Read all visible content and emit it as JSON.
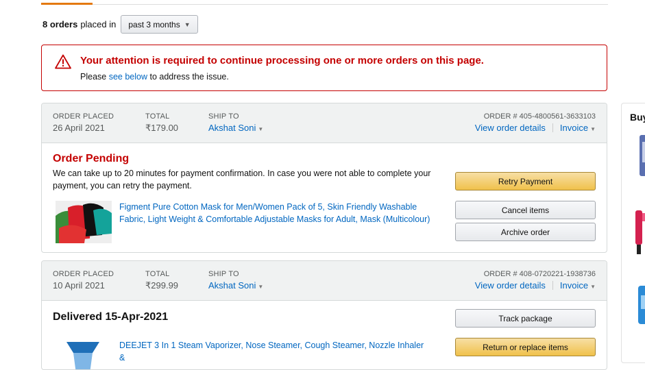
{
  "summary": {
    "count": "8 orders",
    "placed_in": "placed in",
    "period": "past 3 months"
  },
  "alert": {
    "title": "Your attention is required to continue processing one or more orders on this page.",
    "msg_prefix": "Please ",
    "msg_link": "see below",
    "msg_suffix": " to address the issue."
  },
  "header_labels": {
    "order_placed": "ORDER PLACED",
    "total": "TOTAL",
    "ship_to": "SHIP TO"
  },
  "orders": [
    {
      "date": "26 April 2021",
      "total": "₹179.00",
      "ship_to": "Akshat Soni",
      "order_number": "ORDER # 405-4800561-3633103",
      "view_details": "View order details",
      "invoice": "Invoice",
      "status": "Order Pending",
      "status_desc": "We can take up to 20 minutes for payment confirmation. In case you were not able to complete your payment, you can retry the payment.",
      "item_title": "Figment Pure Cotton Mask for Men/Women Pack of 5, Skin Friendly Washable Fabric, Light Weight & Comfortable Adjustable Masks for Adult, Mask (Multicolour)",
      "buttons": [
        "Retry Payment",
        "Cancel items",
        "Archive order"
      ]
    },
    {
      "date": "10 April 2021",
      "total": "₹299.99",
      "ship_to": "Akshat Soni",
      "order_number": "ORDER # 408-0720221-1938736",
      "view_details": "View order details",
      "invoice": "Invoice",
      "status": "Delivered 15-Apr-2021",
      "item_title": "DEEJET 3 In 1 Steam Vaporizer, Nose Steamer, Cough Steamer, Nozzle Inhaler &",
      "buttons": [
        "Track package",
        "Return or replace items"
      ]
    }
  ],
  "sidebar": {
    "title": "Buy"
  },
  "colors": {
    "alert_red": "#c40000",
    "link_blue": "#0066c0",
    "primary_button": "#f0c14b",
    "tab_accent": "#e47911"
  }
}
